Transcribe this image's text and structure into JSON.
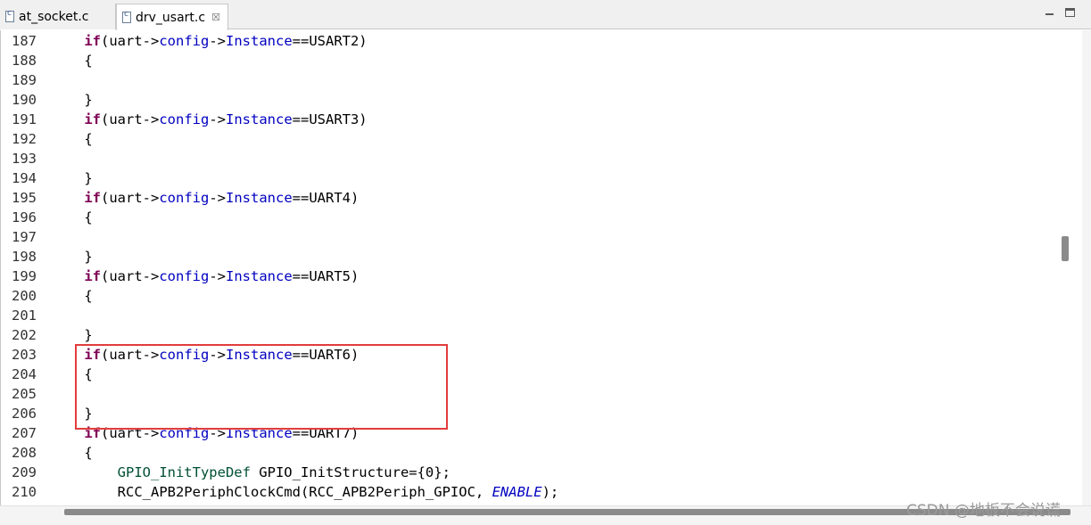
{
  "tabs": [
    {
      "label": "at_socket.c",
      "active": false
    },
    {
      "label": "drv_usart.c",
      "active": true
    }
  ],
  "tab_close_glyph": "☒",
  "code_lines": [
    {
      "num": "187",
      "tokens": [
        [
          "ws",
          "    "
        ],
        [
          "kw",
          "if"
        ],
        [
          "p",
          "(uart->"
        ],
        [
          "field",
          "config"
        ],
        [
          "p",
          "->"
        ],
        [
          "field",
          "Instance"
        ],
        [
          "p",
          "==USART2)"
        ]
      ]
    },
    {
      "num": "188",
      "tokens": [
        [
          "ws",
          "    "
        ],
        [
          "p",
          "{"
        ]
      ]
    },
    {
      "num": "189",
      "tokens": []
    },
    {
      "num": "190",
      "tokens": [
        [
          "ws",
          "    "
        ],
        [
          "p",
          "}"
        ]
      ]
    },
    {
      "num": "191",
      "tokens": [
        [
          "ws",
          "    "
        ],
        [
          "kw",
          "if"
        ],
        [
          "p",
          "(uart->"
        ],
        [
          "field",
          "config"
        ],
        [
          "p",
          "->"
        ],
        [
          "field",
          "Instance"
        ],
        [
          "p",
          "==USART3)"
        ]
      ]
    },
    {
      "num": "192",
      "tokens": [
        [
          "ws",
          "    "
        ],
        [
          "p",
          "{"
        ]
      ]
    },
    {
      "num": "193",
      "tokens": []
    },
    {
      "num": "194",
      "tokens": [
        [
          "ws",
          "    "
        ],
        [
          "p",
          "}"
        ]
      ]
    },
    {
      "num": "195",
      "tokens": [
        [
          "ws",
          "    "
        ],
        [
          "kw",
          "if"
        ],
        [
          "p",
          "(uart->"
        ],
        [
          "field",
          "config"
        ],
        [
          "p",
          "->"
        ],
        [
          "field",
          "Instance"
        ],
        [
          "p",
          "==UART4)"
        ]
      ]
    },
    {
      "num": "196",
      "tokens": [
        [
          "ws",
          "    "
        ],
        [
          "p",
          "{"
        ]
      ]
    },
    {
      "num": "197",
      "tokens": []
    },
    {
      "num": "198",
      "tokens": [
        [
          "ws",
          "    "
        ],
        [
          "p",
          "}"
        ]
      ]
    },
    {
      "num": "199",
      "tokens": [
        [
          "ws",
          "    "
        ],
        [
          "kw",
          "if"
        ],
        [
          "p",
          "(uart->"
        ],
        [
          "field",
          "config"
        ],
        [
          "p",
          "->"
        ],
        [
          "field",
          "Instance"
        ],
        [
          "p",
          "==UART5)"
        ]
      ]
    },
    {
      "num": "200",
      "tokens": [
        [
          "ws",
          "    "
        ],
        [
          "p",
          "{"
        ]
      ]
    },
    {
      "num": "201",
      "tokens": []
    },
    {
      "num": "202",
      "tokens": [
        [
          "ws",
          "    "
        ],
        [
          "p",
          "}"
        ]
      ]
    },
    {
      "num": "203",
      "tokens": [
        [
          "ws",
          "    "
        ],
        [
          "kw",
          "if"
        ],
        [
          "p",
          "(uart->"
        ],
        [
          "field",
          "config"
        ],
        [
          "p",
          "->"
        ],
        [
          "field",
          "Instance"
        ],
        [
          "p",
          "==UART6)"
        ]
      ]
    },
    {
      "num": "204",
      "tokens": [
        [
          "ws",
          "    "
        ],
        [
          "p",
          "{"
        ]
      ]
    },
    {
      "num": "205",
      "tokens": []
    },
    {
      "num": "206",
      "tokens": [
        [
          "ws",
          "    "
        ],
        [
          "p",
          "}"
        ]
      ]
    },
    {
      "num": "207",
      "tokens": [
        [
          "ws",
          "    "
        ],
        [
          "kw",
          "if"
        ],
        [
          "p",
          "(uart->"
        ],
        [
          "field",
          "config"
        ],
        [
          "p",
          "->"
        ],
        [
          "field",
          "Instance"
        ],
        [
          "p",
          "==UART7)"
        ]
      ]
    },
    {
      "num": "208",
      "tokens": [
        [
          "ws",
          "    "
        ],
        [
          "p",
          "{"
        ]
      ]
    },
    {
      "num": "209",
      "tokens": [
        [
          "ws",
          "        "
        ],
        [
          "type",
          "GPIO_InitTypeDef"
        ],
        [
          "p",
          " GPIO_InitStructure={0};"
        ]
      ]
    },
    {
      "num": "210",
      "tokens": [
        [
          "ws",
          "        "
        ],
        [
          "p",
          "RCC_APB2PeriphClockCmd(RCC_APB2Periph_GPIOC, "
        ],
        [
          "enum",
          "ENABLE"
        ],
        [
          "p",
          ");"
        ]
      ]
    }
  ],
  "watermark": "CSDN @地板不会说谎",
  "colors": {
    "keyword": "#7f0055",
    "field": "#0000c0",
    "type": "#005032",
    "highlight_box": "#e23c3c"
  }
}
